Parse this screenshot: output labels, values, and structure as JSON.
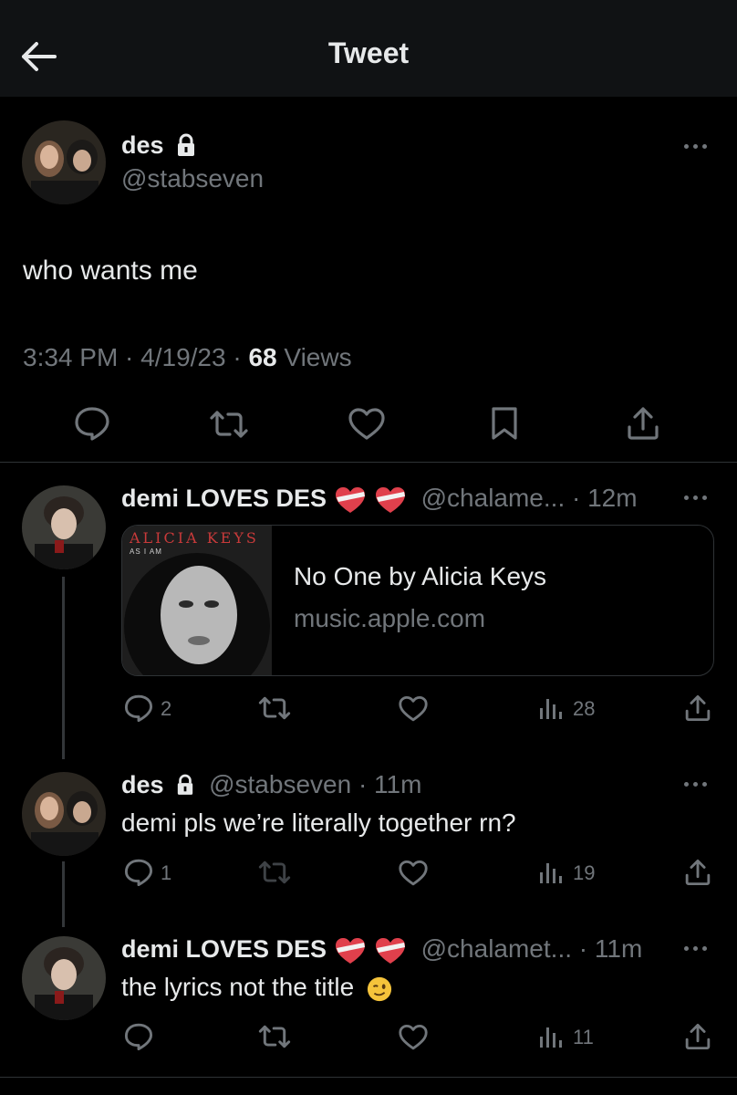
{
  "header": {
    "title": "Tweet"
  },
  "main_tweet": {
    "name": "des",
    "handle": "@stabseven",
    "text": "who wants me",
    "time": "3:34 PM · 4/19/23 · ",
    "views_count": "68",
    "views_label": " Views"
  },
  "replies": [
    {
      "name": "demi LOVES DES",
      "handle_time": "@chalame... · 12m",
      "card": {
        "title": "No One by Alicia Keys",
        "domain": "music.apple.com",
        "art_text": "ALICIA KEYS",
        "art_sub": "AS I AM"
      },
      "reply_count": "2",
      "views": "28"
    },
    {
      "name": "des",
      "handle_time": "@stabseven · 11m",
      "text": "demi pls we’re literally together rn?",
      "reply_count": "1",
      "views": "19"
    },
    {
      "name": "demi LOVES DES",
      "handle_time": "@chalamet... · 11m",
      "text": "the lyrics not the title",
      "views": "11"
    }
  ],
  "colors": {
    "background": "#000000",
    "text": "#e7e9ea",
    "muted": "#71767b",
    "divider": "#2f3336"
  }
}
